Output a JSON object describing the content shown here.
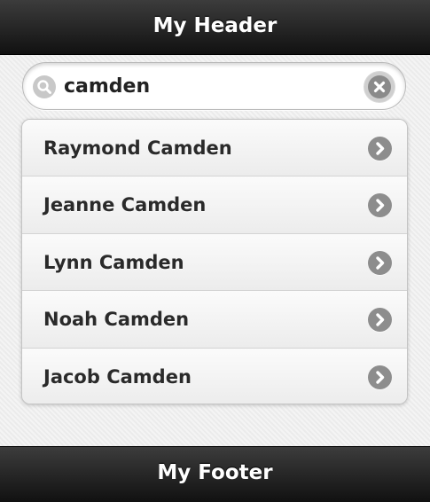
{
  "header": {
    "title": "My Header"
  },
  "search": {
    "value": "camden",
    "placeholder": ""
  },
  "list": {
    "items": [
      {
        "label": "Raymond Camden"
      },
      {
        "label": "Jeanne Camden"
      },
      {
        "label": "Lynn Camden"
      },
      {
        "label": "Noah Camden"
      },
      {
        "label": "Jacob Camden"
      }
    ]
  },
  "footer": {
    "title": "My Footer"
  },
  "icons": {
    "search": "search-icon",
    "clear": "close-icon",
    "chevron": "chevron-right-icon"
  },
  "colors": {
    "bar_background": "#1f1f1f",
    "content_background": "#f0f0f0",
    "icon_gray": "#8d8d8d"
  }
}
